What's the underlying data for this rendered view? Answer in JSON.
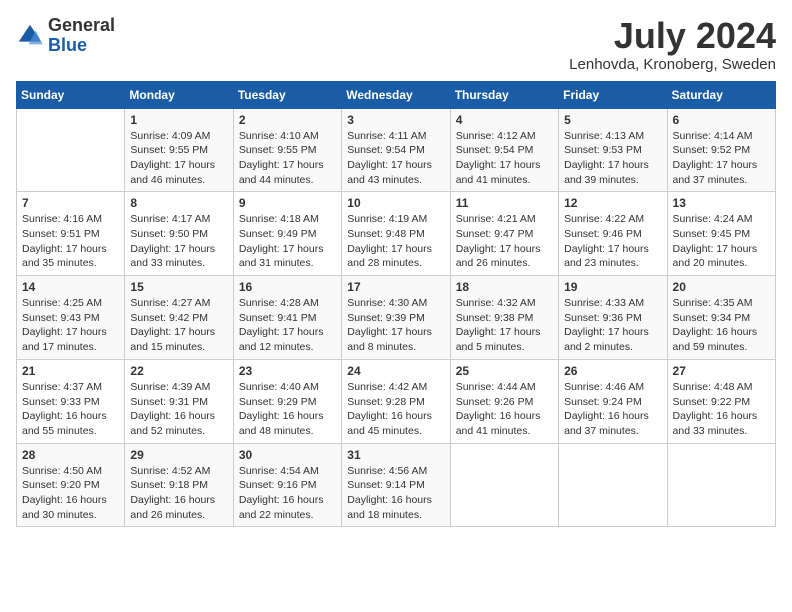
{
  "header": {
    "logo_general": "General",
    "logo_blue": "Blue",
    "month_year": "July 2024",
    "location": "Lenhovda, Kronoberg, Sweden"
  },
  "days_of_week": [
    "Sunday",
    "Monday",
    "Tuesday",
    "Wednesday",
    "Thursday",
    "Friday",
    "Saturday"
  ],
  "weeks": [
    [
      {
        "day": "",
        "sunrise": "",
        "sunset": "",
        "daylight": ""
      },
      {
        "day": "1",
        "sunrise": "Sunrise: 4:09 AM",
        "sunset": "Sunset: 9:55 PM",
        "daylight": "Daylight: 17 hours and 46 minutes."
      },
      {
        "day": "2",
        "sunrise": "Sunrise: 4:10 AM",
        "sunset": "Sunset: 9:55 PM",
        "daylight": "Daylight: 17 hours and 44 minutes."
      },
      {
        "day": "3",
        "sunrise": "Sunrise: 4:11 AM",
        "sunset": "Sunset: 9:54 PM",
        "daylight": "Daylight: 17 hours and 43 minutes."
      },
      {
        "day": "4",
        "sunrise": "Sunrise: 4:12 AM",
        "sunset": "Sunset: 9:54 PM",
        "daylight": "Daylight: 17 hours and 41 minutes."
      },
      {
        "day": "5",
        "sunrise": "Sunrise: 4:13 AM",
        "sunset": "Sunset: 9:53 PM",
        "daylight": "Daylight: 17 hours and 39 minutes."
      },
      {
        "day": "6",
        "sunrise": "Sunrise: 4:14 AM",
        "sunset": "Sunset: 9:52 PM",
        "daylight": "Daylight: 17 hours and 37 minutes."
      }
    ],
    [
      {
        "day": "7",
        "sunrise": "Sunrise: 4:16 AM",
        "sunset": "Sunset: 9:51 PM",
        "daylight": "Daylight: 17 hours and 35 minutes."
      },
      {
        "day": "8",
        "sunrise": "Sunrise: 4:17 AM",
        "sunset": "Sunset: 9:50 PM",
        "daylight": "Daylight: 17 hours and 33 minutes."
      },
      {
        "day": "9",
        "sunrise": "Sunrise: 4:18 AM",
        "sunset": "Sunset: 9:49 PM",
        "daylight": "Daylight: 17 hours and 31 minutes."
      },
      {
        "day": "10",
        "sunrise": "Sunrise: 4:19 AM",
        "sunset": "Sunset: 9:48 PM",
        "daylight": "Daylight: 17 hours and 28 minutes."
      },
      {
        "day": "11",
        "sunrise": "Sunrise: 4:21 AM",
        "sunset": "Sunset: 9:47 PM",
        "daylight": "Daylight: 17 hours and 26 minutes."
      },
      {
        "day": "12",
        "sunrise": "Sunrise: 4:22 AM",
        "sunset": "Sunset: 9:46 PM",
        "daylight": "Daylight: 17 hours and 23 minutes."
      },
      {
        "day": "13",
        "sunrise": "Sunrise: 4:24 AM",
        "sunset": "Sunset: 9:45 PM",
        "daylight": "Daylight: 17 hours and 20 minutes."
      }
    ],
    [
      {
        "day": "14",
        "sunrise": "Sunrise: 4:25 AM",
        "sunset": "Sunset: 9:43 PM",
        "daylight": "Daylight: 17 hours and 17 minutes."
      },
      {
        "day": "15",
        "sunrise": "Sunrise: 4:27 AM",
        "sunset": "Sunset: 9:42 PM",
        "daylight": "Daylight: 17 hours and 15 minutes."
      },
      {
        "day": "16",
        "sunrise": "Sunrise: 4:28 AM",
        "sunset": "Sunset: 9:41 PM",
        "daylight": "Daylight: 17 hours and 12 minutes."
      },
      {
        "day": "17",
        "sunrise": "Sunrise: 4:30 AM",
        "sunset": "Sunset: 9:39 PM",
        "daylight": "Daylight: 17 hours and 8 minutes."
      },
      {
        "day": "18",
        "sunrise": "Sunrise: 4:32 AM",
        "sunset": "Sunset: 9:38 PM",
        "daylight": "Daylight: 17 hours and 5 minutes."
      },
      {
        "day": "19",
        "sunrise": "Sunrise: 4:33 AM",
        "sunset": "Sunset: 9:36 PM",
        "daylight": "Daylight: 17 hours and 2 minutes."
      },
      {
        "day": "20",
        "sunrise": "Sunrise: 4:35 AM",
        "sunset": "Sunset: 9:34 PM",
        "daylight": "Daylight: 16 hours and 59 minutes."
      }
    ],
    [
      {
        "day": "21",
        "sunrise": "Sunrise: 4:37 AM",
        "sunset": "Sunset: 9:33 PM",
        "daylight": "Daylight: 16 hours and 55 minutes."
      },
      {
        "day": "22",
        "sunrise": "Sunrise: 4:39 AM",
        "sunset": "Sunset: 9:31 PM",
        "daylight": "Daylight: 16 hours and 52 minutes."
      },
      {
        "day": "23",
        "sunrise": "Sunrise: 4:40 AM",
        "sunset": "Sunset: 9:29 PM",
        "daylight": "Daylight: 16 hours and 48 minutes."
      },
      {
        "day": "24",
        "sunrise": "Sunrise: 4:42 AM",
        "sunset": "Sunset: 9:28 PM",
        "daylight": "Daylight: 16 hours and 45 minutes."
      },
      {
        "day": "25",
        "sunrise": "Sunrise: 4:44 AM",
        "sunset": "Sunset: 9:26 PM",
        "daylight": "Daylight: 16 hours and 41 minutes."
      },
      {
        "day": "26",
        "sunrise": "Sunrise: 4:46 AM",
        "sunset": "Sunset: 9:24 PM",
        "daylight": "Daylight: 16 hours and 37 minutes."
      },
      {
        "day": "27",
        "sunrise": "Sunrise: 4:48 AM",
        "sunset": "Sunset: 9:22 PM",
        "daylight": "Daylight: 16 hours and 33 minutes."
      }
    ],
    [
      {
        "day": "28",
        "sunrise": "Sunrise: 4:50 AM",
        "sunset": "Sunset: 9:20 PM",
        "daylight": "Daylight: 16 hours and 30 minutes."
      },
      {
        "day": "29",
        "sunrise": "Sunrise: 4:52 AM",
        "sunset": "Sunset: 9:18 PM",
        "daylight": "Daylight: 16 hours and 26 minutes."
      },
      {
        "day": "30",
        "sunrise": "Sunrise: 4:54 AM",
        "sunset": "Sunset: 9:16 PM",
        "daylight": "Daylight: 16 hours and 22 minutes."
      },
      {
        "day": "31",
        "sunrise": "Sunrise: 4:56 AM",
        "sunset": "Sunset: 9:14 PM",
        "daylight": "Daylight: 16 hours and 18 minutes."
      },
      {
        "day": "",
        "sunrise": "",
        "sunset": "",
        "daylight": ""
      },
      {
        "day": "",
        "sunrise": "",
        "sunset": "",
        "daylight": ""
      },
      {
        "day": "",
        "sunrise": "",
        "sunset": "",
        "daylight": ""
      }
    ]
  ]
}
